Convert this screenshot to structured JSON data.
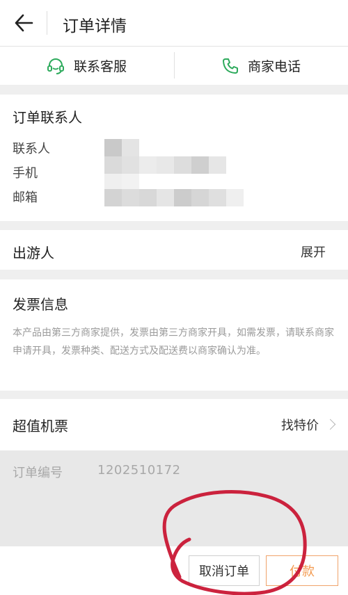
{
  "header": {
    "title": "订单详情"
  },
  "contact_bar": {
    "service_label": "联系客服",
    "merchant_phone_label": "商家电话"
  },
  "order_contact": {
    "title": "订单联系人",
    "fields": {
      "name_label": "联系人",
      "phone_label": "手机",
      "email_label": "邮箱"
    }
  },
  "traveler": {
    "title": "出游人",
    "action": "展开"
  },
  "invoice": {
    "title": "发票信息",
    "note": "本产品由第三方商家提供，发票由第三方商家开具，如需发票，请联系商家申请开具，发票种类、配送方式及配送费以商家确认为准。"
  },
  "flight": {
    "title": "超值机票",
    "action": "找特价"
  },
  "order": {
    "number_label": "订单编号",
    "number_value": "1202510172"
  },
  "footer": {
    "cancel_label": "取消订单",
    "pay_label": "付款"
  },
  "colors": {
    "accent_green": "#2daa5c",
    "pay_orange": "#f39a4f",
    "annotation_red": "#c8102e"
  }
}
